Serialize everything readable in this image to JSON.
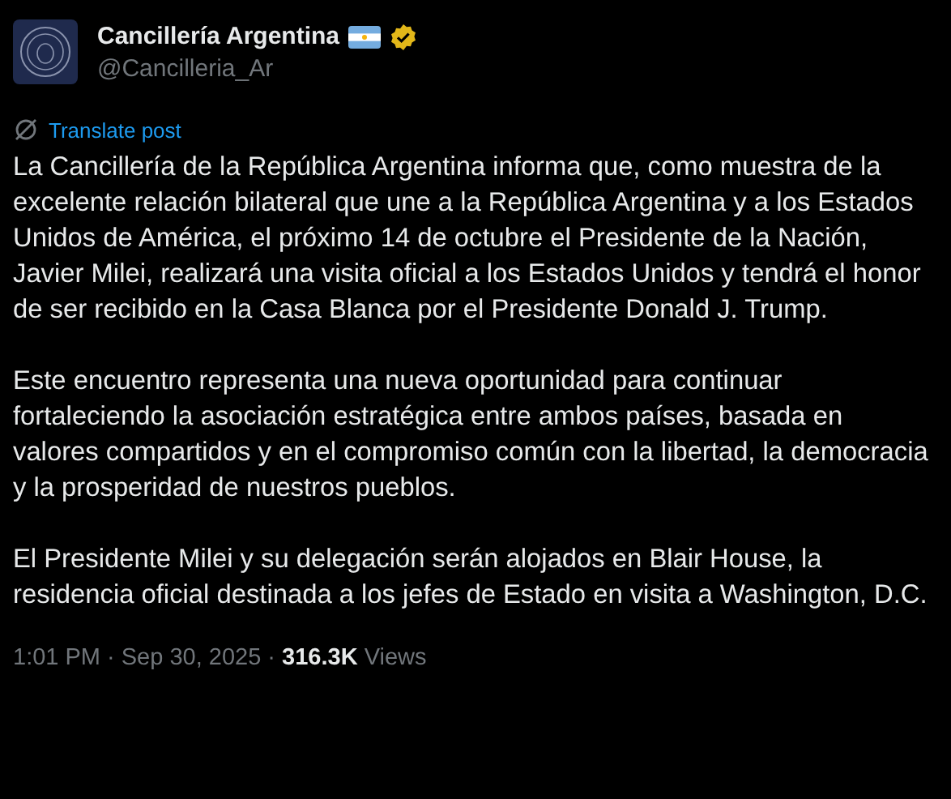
{
  "account": {
    "name": "Cancillería Argentina",
    "handle": "@Cancilleria_Ar",
    "verified": true
  },
  "translate": "Translate post",
  "paragraphs": [
    "La Cancillería de la República Argentina informa que, como muestra de la excelente relación bilateral que une a la República Argentina y a los Estados Unidos de América, el próximo 14 de octubre el Presidente de la Nación, Javier Milei, realizará una visita oficial a los Estados Unidos y tendrá el honor de ser recibido en la Casa Blanca por el Presidente Donald J. Trump.",
    "Este encuentro representa una nueva oportunidad para continuar fortaleciendo la asociación estratégica entre ambos países, basada en valores compartidos y en el compromiso común con la libertad, la democracia y la prosperidad de nuestros pueblos.",
    "El Presidente Milei y su delegación serán alojados en Blair House, la residencia oficial destinada a los jefes de Estado en visita a Washington, D.C."
  ],
  "meta": "1:01 PM · Sep 30, 2025 · **316.3K** Views"
}
